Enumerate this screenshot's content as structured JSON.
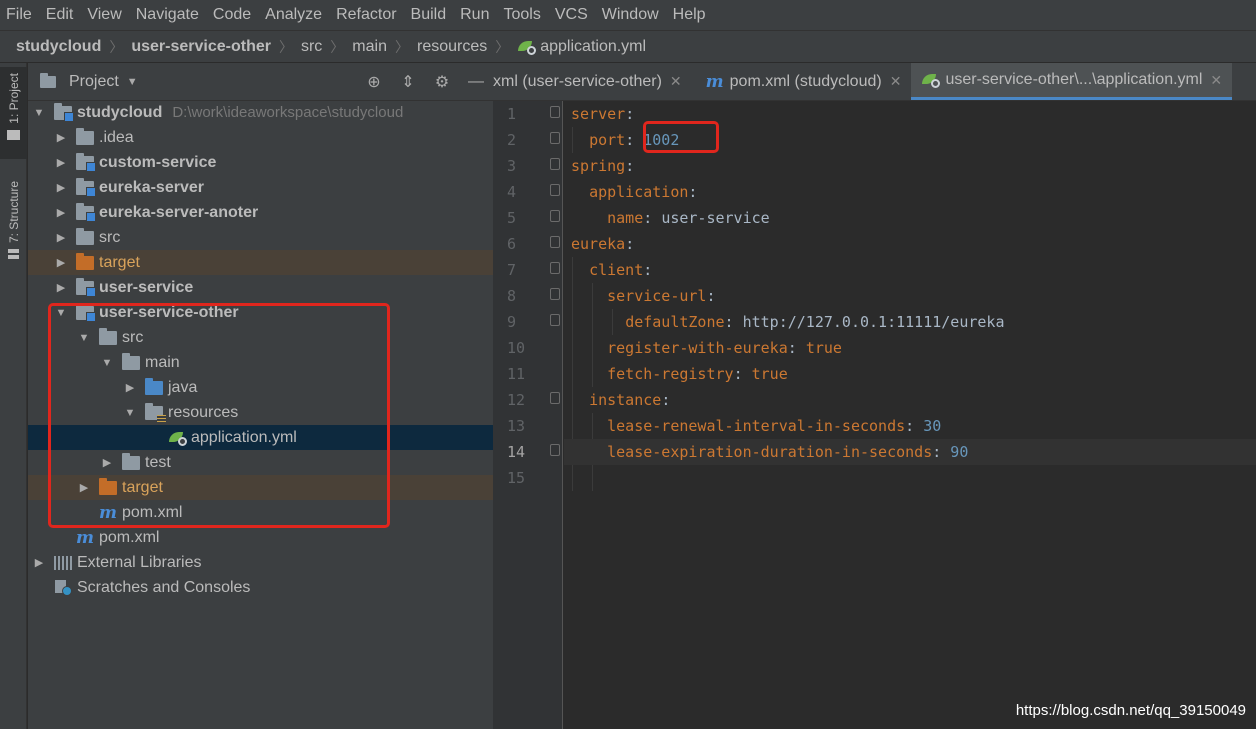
{
  "menu": [
    "File",
    "Edit",
    "View",
    "Navigate",
    "Code",
    "Analyze",
    "Refactor",
    "Build",
    "Run",
    "Tools",
    "VCS",
    "Window",
    "Help"
  ],
  "breadcrumb": [
    "studycloud",
    "user-service-other",
    "src",
    "main",
    "resources",
    "application.yml"
  ],
  "toolstrip": {
    "project": "1: Project",
    "structure": "7: Structure"
  },
  "project_panel": {
    "title": "Project"
  },
  "tree": [
    {
      "label": "studycloud",
      "path": "D:\\work\\ideaworkspace\\studycloud"
    },
    {
      "label": ".idea"
    },
    {
      "label": "custom-service"
    },
    {
      "label": "eureka-server"
    },
    {
      "label": "eureka-server-anoter"
    },
    {
      "label": "src"
    },
    {
      "label": "target"
    },
    {
      "label": "user-service"
    },
    {
      "label": "user-service-other"
    },
    {
      "label": "src"
    },
    {
      "label": "main"
    },
    {
      "label": "java"
    },
    {
      "label": "resources"
    },
    {
      "label": "application.yml"
    },
    {
      "label": "test"
    },
    {
      "label": "target"
    },
    {
      "label": "pom.xml"
    },
    {
      "label": "pom.xml"
    },
    {
      "label": "External Libraries"
    },
    {
      "label": "Scratches and Consoles"
    }
  ],
  "tabs": [
    {
      "label": "xml (user-service-other)"
    },
    {
      "label": "pom.xml (studycloud)"
    },
    {
      "label": "user-service-other\\...\\application.yml"
    }
  ],
  "code": {
    "line_numbers": [
      "1",
      "2",
      "3",
      "4",
      "5",
      "6",
      "7",
      "8",
      "9",
      "10",
      "11",
      "12",
      "13",
      "14",
      "15"
    ],
    "current_line": 14,
    "lines": [
      {
        "key": "server",
        "sep": ":",
        "val": ""
      },
      {
        "key": "port",
        "sep": ": ",
        "val": "1002"
      },
      {
        "key": "spring",
        "sep": ":",
        "val": ""
      },
      {
        "key": "application",
        "sep": ":",
        "val": ""
      },
      {
        "key": "name",
        "sep": ": ",
        "val": "user-service"
      },
      {
        "key": "eureka",
        "sep": ":",
        "val": ""
      },
      {
        "key": "client",
        "sep": ":",
        "val": ""
      },
      {
        "key": "service-url",
        "sep": ":",
        "val": ""
      },
      {
        "key": "defaultZone",
        "sep": ": ",
        "val": "http://127.0.0.1:11111/eureka"
      },
      {
        "key": "register-with-eureka",
        "sep": ": ",
        "val": "true"
      },
      {
        "key": "fetch-registry",
        "sep": ": ",
        "val": "true"
      },
      {
        "key": "instance",
        "sep": ":",
        "val": ""
      },
      {
        "key": "lease-renewal-interval-in-seconds",
        "sep": ": ",
        "val": "30"
      },
      {
        "key": "lease-expiration-duration-in-seconds",
        "sep": ": ",
        "val": "90"
      },
      {
        "key": "",
        "sep": "",
        "val": ""
      }
    ]
  },
  "watermark": "https://blog.csdn.net/qq_39150049",
  "colors": {
    "accent": "#4a88c7",
    "highlight_box": "#e0261d",
    "yaml_key": "#cc7832",
    "yaml_number": "#6897bb"
  }
}
